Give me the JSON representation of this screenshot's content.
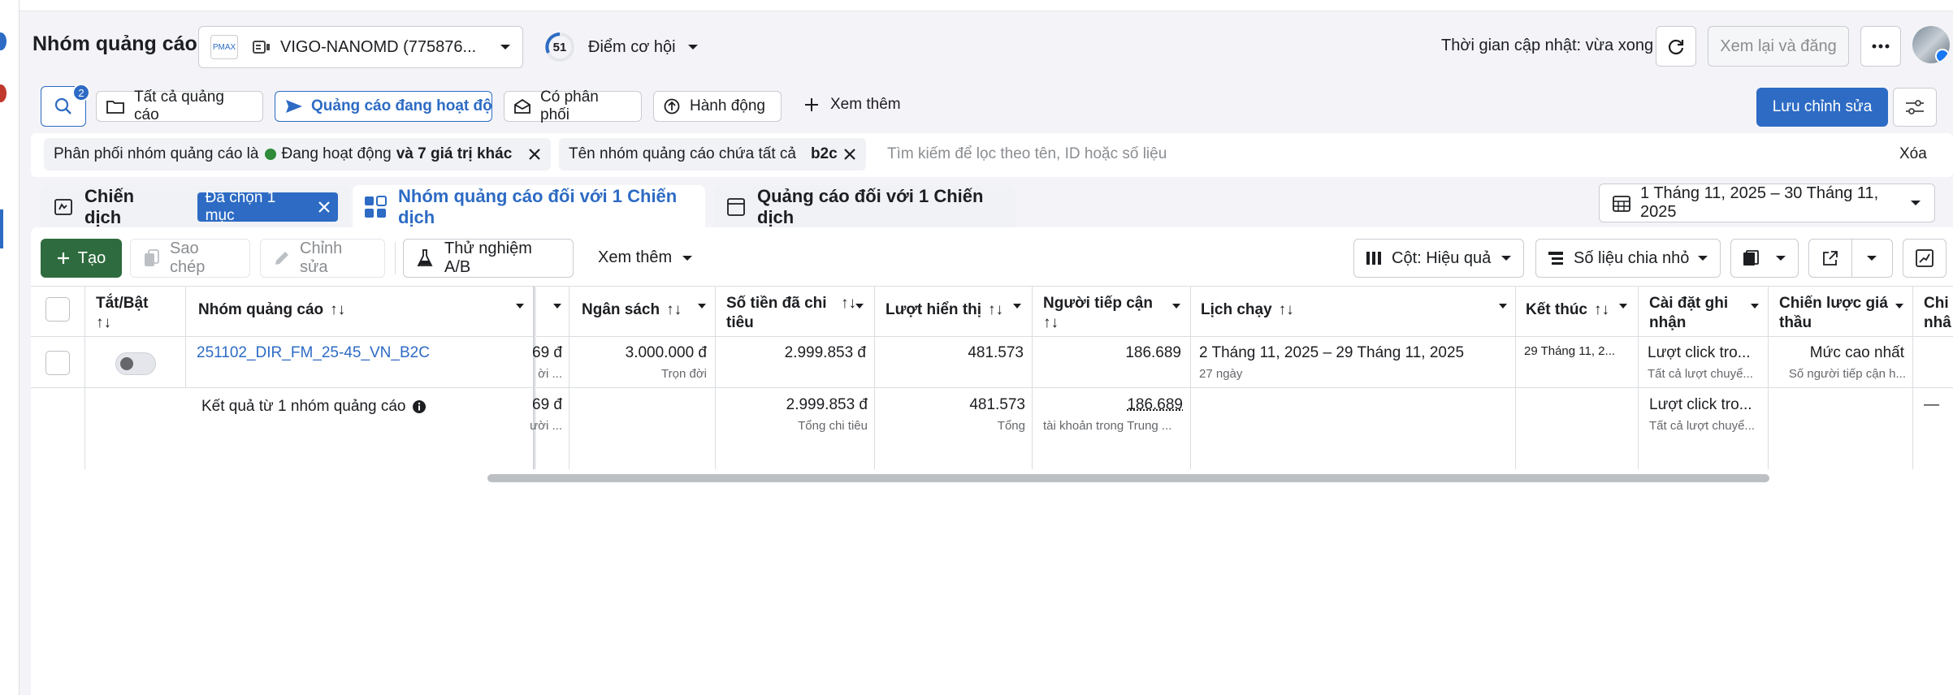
{
  "header": {
    "page_title": "Nhóm quảng cáo",
    "account_name": "VIGO-NANOMD (775876...",
    "account_logo_text": "PMAX",
    "opportunity_score": "51",
    "opportunity_label": "Điểm cơ hội",
    "update_time": "Thời gian cập nhật: vừa xong",
    "review_publish": "Xem lại và đăng"
  },
  "toolbar": {
    "search_badge": "2",
    "filters": [
      "Tất cả quảng cáo",
      "Quảng cáo đang hoạt động",
      "Có phân phối",
      "Hành động"
    ],
    "see_more": "Xem thêm",
    "save_edits": "Lưu chỉnh sửa"
  },
  "filter_bar": {
    "chip1_prefix": "Phân phối nhóm quảng cáo là",
    "chip1_status": "Đang hoạt động",
    "chip1_suffix": "và 7 giá trị khác",
    "chip2_prefix": "Tên nhóm quảng cáo chứa tất cả",
    "chip2_value": "b2c",
    "search_placeholder": "Tìm kiếm để lọc theo tên, ID hoặc số liệu",
    "clear": "Xóa"
  },
  "tabs": {
    "campaign": "Chiến dịch",
    "selected_badge": "Đã chọn 1 mục",
    "adsets": "Nhóm quảng cáo đối với 1 Chiến dịch",
    "ads": "Quảng cáo đối với 1 Chiến dịch",
    "date_range": "1 Tháng 11, 2025 – 30 Tháng 11, 2025"
  },
  "actions": {
    "create": "Tạo",
    "duplicate": "Sao chép",
    "edit": "Chỉnh sửa",
    "ab_test": "Thử nghiệm A/B",
    "more": "Xem thêm",
    "columns": "Cột: Hiệu quả",
    "breakdown": "Số liệu chia nhỏ"
  },
  "table": {
    "headers": {
      "toggle": "Tắt/Bật",
      "adset": "Nhóm quảng cáo",
      "budget": "Ngân sách",
      "spend": "Số tiền đã chi tiêu",
      "impressions": "Lượt hiển thị",
      "reach": "Người tiếp cận",
      "schedule": "Lịch chạy",
      "ends": "Kết thúc",
      "attribution": "Cài đặt ghi nhận",
      "bid_strategy": "Chiến lược giá thầu",
      "extra": "Chi nhâ"
    },
    "row": {
      "name": "251102_DIR_FM_25-45_VN_B2C",
      "partial_value": "69 đ",
      "partial_sub": "ời ...",
      "budget": "3.000.000 đ",
      "budget_sub": "Trọn đời",
      "spend": "2.999.853 đ",
      "impressions": "481.573",
      "reach": "186.689",
      "schedule": "2 Tháng 11, 2025 – 29 Tháng 11, 2025",
      "schedule_sub": "27 ngày",
      "ends": "29 Tháng 11, 2...",
      "attribution": "Lượt click tro...",
      "attribution_sub": "Tất cả lượt chuyể...",
      "bid": "Mức cao nhất",
      "bid_sub": "Số người tiếp cận h..."
    },
    "summary": {
      "label": "Kết quả từ 1 nhóm quảng cáo",
      "partial_value": "69 đ",
      "partial_sub": "ười ...",
      "spend": "2.999.853 đ",
      "spend_sub": "Tổng chi tiêu",
      "impressions": "481.573",
      "impressions_sub": "Tổng",
      "reach": "186.689",
      "reach_sub": "tài khoản trong Trung ...",
      "attribution": "Lượt click tro...",
      "attribution_sub": "Tất cả lượt chuyể...",
      "extra": "—"
    }
  },
  "colors": {
    "primary": "#2d6bc4",
    "create_green": "#2e6b3e",
    "active_green": "#2f8a3a",
    "link": "#2d6bc4"
  }
}
